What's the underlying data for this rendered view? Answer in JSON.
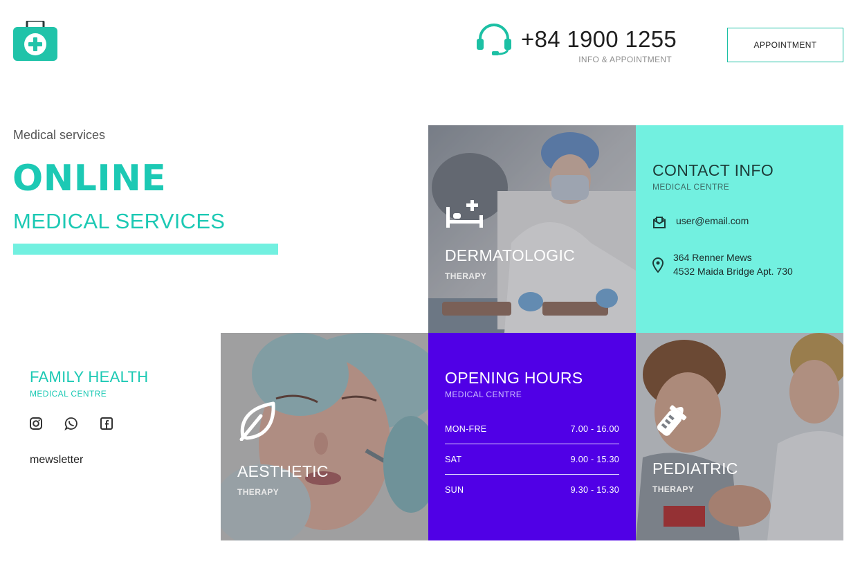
{
  "header": {
    "logo": "first-aid-kit-icon",
    "phone_icon": "headset-icon",
    "phone_number": "+84 1900 1255",
    "phone_sub": "INFO & APPOINTMENT",
    "appointment_label": "APPOINTMENT"
  },
  "hero": {
    "eyebrow": "Medical services",
    "title": "ONLINE",
    "subtitle": "MEDICAL SERVICES"
  },
  "services": {
    "dermatologic": {
      "icon": "hospital-bed-icon",
      "title": "DERMATOLOGIC",
      "sub": "THERAPY"
    },
    "aesthetic": {
      "icon": "leaf-icon",
      "title": "AESTHETIC",
      "sub": "THERAPY"
    },
    "pediatric": {
      "icon": "baby-bottle-icon",
      "title": "PEDIATRIC",
      "sub": "THERAPY"
    }
  },
  "contact": {
    "title": "CONTACT INFO",
    "sub": "MEDICAL CENTRE",
    "email": "user@email.com",
    "address_line1": "364 Renner Mews",
    "address_line2": "4532 Maida Bridge Apt. 730"
  },
  "hours": {
    "title": "OPENING HOURS",
    "sub": "MEDICAL CENTRE",
    "rows": [
      {
        "day": "MON-FRE",
        "time": "7.00 - 16.00"
      },
      {
        "day": "SAT",
        "time": "9.00 - 15.30"
      },
      {
        "day": "SUN",
        "time": "9.30 - 15.30"
      }
    ]
  },
  "family": {
    "title": "FAMILY HEALTH",
    "sub": "MEDICAL CENTRE",
    "social": [
      "instagram-icon",
      "whatsapp-icon",
      "facebook-icon"
    ],
    "newsletter": "mewsletter"
  },
  "colors": {
    "teal": "#1cc9b4",
    "mint": "#72f0e0",
    "purple": "#5000e6"
  }
}
